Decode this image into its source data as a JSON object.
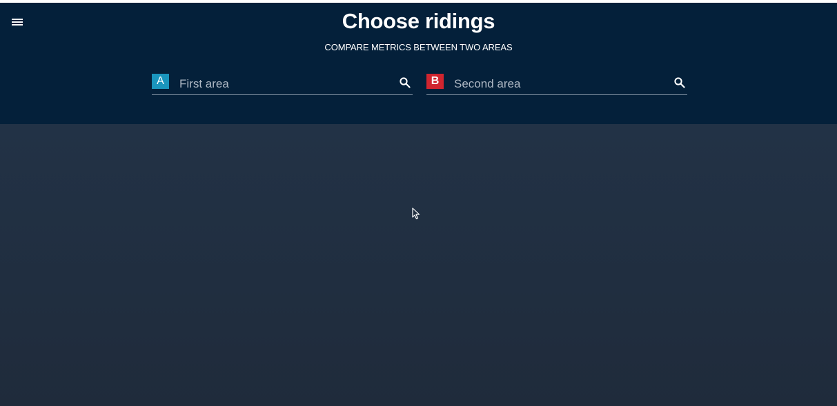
{
  "header": {
    "title": "Choose ridings",
    "subtitle": "COMPARE METRICS BETWEEN TWO AREAS",
    "menu_icon": "hamburger-menu-icon"
  },
  "search": {
    "first": {
      "badge": "A",
      "badge_color": "#1a95bd",
      "placeholder": "First area",
      "value": "",
      "icon": "search-icon"
    },
    "second": {
      "badge": "B",
      "badge_color": "#d0252f",
      "placeholder": "Second area",
      "value": "",
      "icon": "search-icon"
    }
  },
  "colors": {
    "header_bg": "#04203a",
    "content_bg": "#1f2d3e",
    "text": "#ffffff"
  }
}
